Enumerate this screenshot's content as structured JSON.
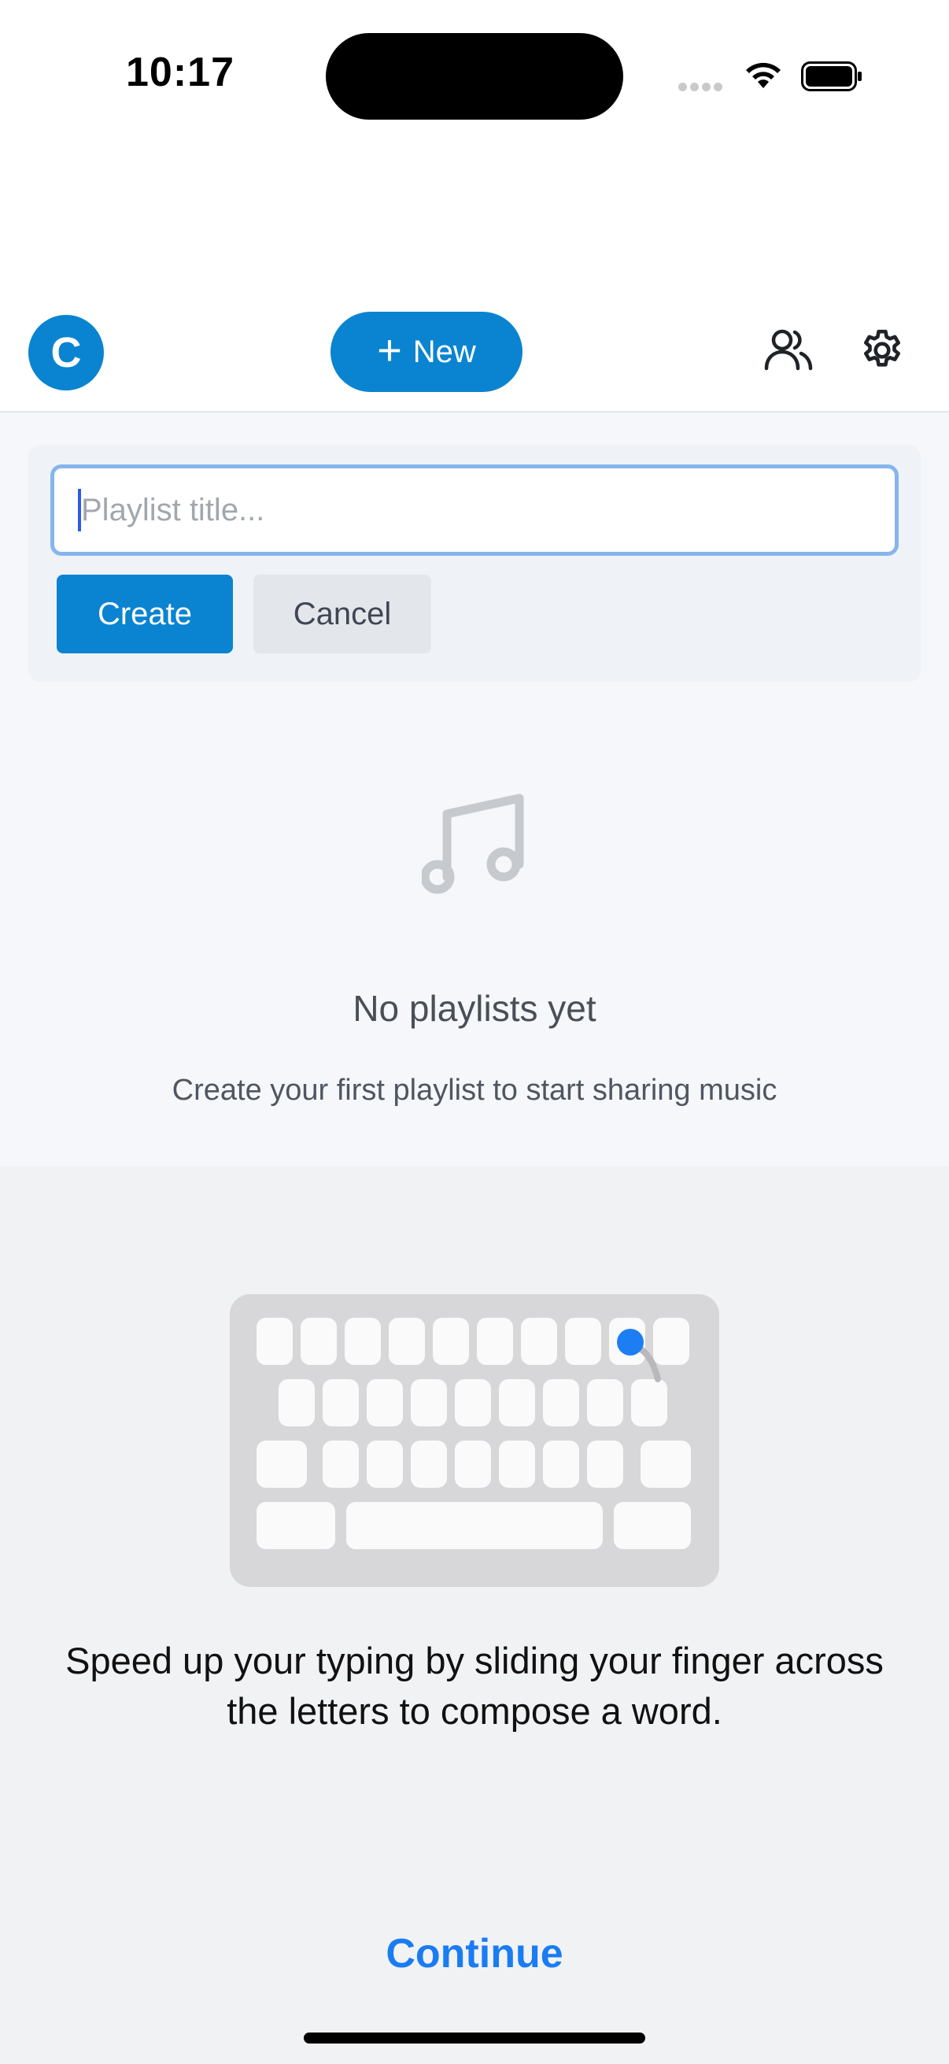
{
  "status_bar": {
    "time": "10:17"
  },
  "header": {
    "avatar_letter": "C",
    "new_button_label": "New",
    "icons": [
      "plus-icon",
      "friends-icon",
      "gear-icon"
    ]
  },
  "playlist_form": {
    "title_placeholder": "Playlist title...",
    "create_label": "Create",
    "cancel_label": "Cancel"
  },
  "empty_state": {
    "icon": "music-note-icon",
    "title": "No playlists yet",
    "subtitle": "Create your first playlist to start sharing music"
  },
  "keyboard_tip": {
    "text": "Speed up your typing by sliding your finger across the letters to compose a word.",
    "continue_label": "Continue"
  },
  "colors": {
    "accent": "#0a84d0",
    "input_focus": "#86b5ee",
    "continue_link": "#1a7cf2"
  }
}
